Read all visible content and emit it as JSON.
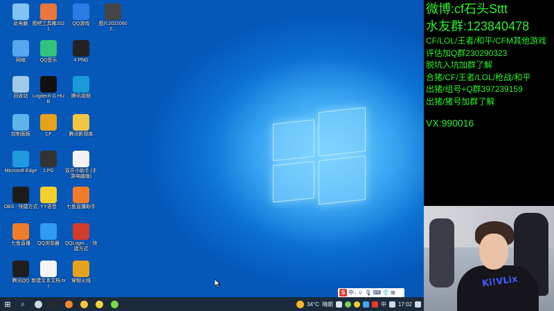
{
  "desktop": {
    "icons": [
      {
        "label": "此电脑",
        "icon": "computer-icon",
        "color": "#7fc4f5"
      },
      {
        "label": "图吧工具箱2021",
        "icon": "toolbox-icon",
        "color": "#e9773b"
      },
      {
        "label": "QQ游戏",
        "icon": "qq-game-icon",
        "color": "#2c7be5"
      },
      {
        "label": "图片20220602...",
        "icon": "photo-icon",
        "color": "#444"
      },
      {
        "label": "网络",
        "icon": "network-icon",
        "color": "#55a8f0"
      },
      {
        "label": "QQ音乐",
        "icon": "qq-music-icon",
        "color": "#31c27c"
      },
      {
        "label": "4.PNG",
        "icon": "image-file-icon",
        "color": "#222"
      },
      {
        "label": "回收站",
        "icon": "recycle-bin-icon",
        "color": "#9fcbe8"
      },
      {
        "label": "Logitech G HUB",
        "icon": "logitech-icon",
        "color": "#111"
      },
      {
        "label": "腾讯视频",
        "icon": "tencent-video-icon",
        "color": "#1a9bd8"
      },
      {
        "label": "控制面板",
        "icon": "control-panel-icon",
        "color": "#5db3ea"
      },
      {
        "label": "CF",
        "icon": "cf-game-icon",
        "color": "#e6a21b"
      },
      {
        "label": "腾讯影视库",
        "icon": "folder-icon",
        "color": "#f3c643"
      },
      {
        "label": "Microsoft Edge",
        "icon": "edge-icon",
        "color": "#1e9be0"
      },
      {
        "label": "1.PG",
        "icon": "image-file-icon",
        "color": "#333"
      },
      {
        "label": "双开小助手 (手游电脑版)",
        "icon": "document-icon",
        "color": "#f2f2f2"
      },
      {
        "label": "OBS - 快捷方式",
        "icon": "obs-icon",
        "color": "#1c1c1c"
      },
      {
        "label": "YY语音",
        "icon": "yy-voice-icon",
        "color": "#f4d02c"
      },
      {
        "label": "七鱼直播助手",
        "icon": "live-assistant-icon",
        "color": "#f07c2a"
      },
      {
        "label": "七鱼直播",
        "icon": "live-app-icon",
        "color": "#f07c2a"
      },
      {
        "label": "QQ浏览器",
        "icon": "qq-browser-icon",
        "color": "#2f9bf2"
      },
      {
        "label": "QQLogin... - 快捷方式",
        "icon": "cf-login-icon",
        "color": "#d23b2a"
      },
      {
        "label": "腾讯QQ",
        "icon": "qq-icon",
        "color": "#1e1e1e"
      },
      {
        "label": "新建文本文档.txt",
        "icon": "text-file-icon",
        "color": "#f5f5f5"
      },
      {
        "label": "穿越火线",
        "icon": "crossfire-icon",
        "color": "#e6a21b"
      }
    ]
  },
  "taskbar": {
    "start_glyph": "⊞",
    "search_glyph": "⌕",
    "apps": [
      {
        "icon": "task-view-icon",
        "color": "#cfd8e3"
      },
      {
        "icon": "obs-taskbar-icon",
        "color": "#2a2a2a"
      },
      {
        "icon": "browser-taskbar-icon",
        "color": "#f08a2c"
      },
      {
        "icon": "folder-taskbar-icon",
        "color": "#f3c643"
      },
      {
        "icon": "game-taskbar-icon",
        "color": "#f2d13a"
      },
      {
        "icon": "app-taskbar-icon",
        "color": "#7bd64a"
      }
    ],
    "weather_temp": "34°C",
    "weather_text": "晴朗",
    "ime_lang": "中",
    "clock": "17:02"
  },
  "ime_bar": {
    "logo": "S",
    "lang": "中",
    "items": [
      "ᵢ",
      "☺",
      "🎙",
      "⌨",
      "👕",
      "⊞"
    ]
  },
  "overlay": {
    "weibo": "微博:cf石头Sttt",
    "fan_group": "水友群:123840478",
    "lines": [
      "CF/LOL/王者/和平/CFM其他游戏",
      "评估加Q群230290323",
      "脱坑入坑加群了解",
      "合猪/CF/王者/LOL/枪战/和平",
      "出猪/组号+Q群397239159",
      "出猪/猪号加群了解"
    ],
    "vx": "VX:990016"
  },
  "webcam": {
    "shirt_print": "Ki!VLix"
  },
  "colors": {
    "overlay_text": "#2ef02e",
    "taskbar_bg": "#1b2a3a"
  }
}
